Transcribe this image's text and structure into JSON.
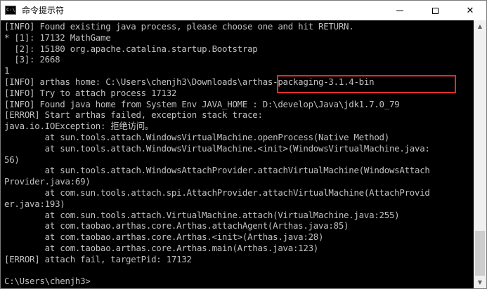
{
  "window": {
    "title": "命令提示符",
    "icon_glyph": "C:\\",
    "close_glyph": "✕"
  },
  "console": {
    "lines": [
      "[INFO] Found existing java process, please choose one and hit RETURN.",
      "* [1]: 17132 MathGame",
      "  [2]: 15180 org.apache.catalina.startup.Bootstrap",
      "  [3]: 2668",
      "1",
      "[INFO] arthas home: C:\\Users\\chenjh3\\Downloads\\arthas-packaging-3.1.4-bin",
      "[INFO] Try to attach process 17132",
      "[INFO] Found java home from System Env JAVA_HOME : D:\\develop\\Java\\jdk1.7.0_79",
      "[ERROR] Start arthas failed, exception stack trace:",
      "java.io.IOException: 拒绝访问。",
      "        at sun.tools.attach.WindowsVirtualMachine.openProcess(Native Method)",
      "        at sun.tools.attach.WindowsVirtualMachine.<init>(WindowsVirtualMachine.java:",
      "56)",
      "        at sun.tools.attach.WindowsAttachProvider.attachVirtualMachine(WindowsAttach",
      "Provider.java:69)",
      "        at com.sun.tools.attach.spi.AttachProvider.attachVirtualMachine(AttachProvid",
      "er.java:193)",
      "        at com.sun.tools.attach.VirtualMachine.attach(VirtualMachine.java:255)",
      "        at com.taobao.arthas.core.Arthas.attachAgent(Arthas.java:85)",
      "        at com.taobao.arthas.core.Arthas.<init>(Arthas.java:28)",
      "        at com.taobao.arthas.core.Arthas.main(Arthas.java:123)",
      "[ERROR] attach fail, targetPid: 17132",
      "",
      "C:\\Users\\chenjh3>"
    ]
  },
  "colors": {
    "text": "#c0c0c0",
    "background": "#000000",
    "highlight": "#e32b2b"
  },
  "icons": {
    "app": "cmd-icon",
    "minimize": "minimize-icon",
    "maximize": "maximize-icon",
    "close": "close-icon"
  }
}
